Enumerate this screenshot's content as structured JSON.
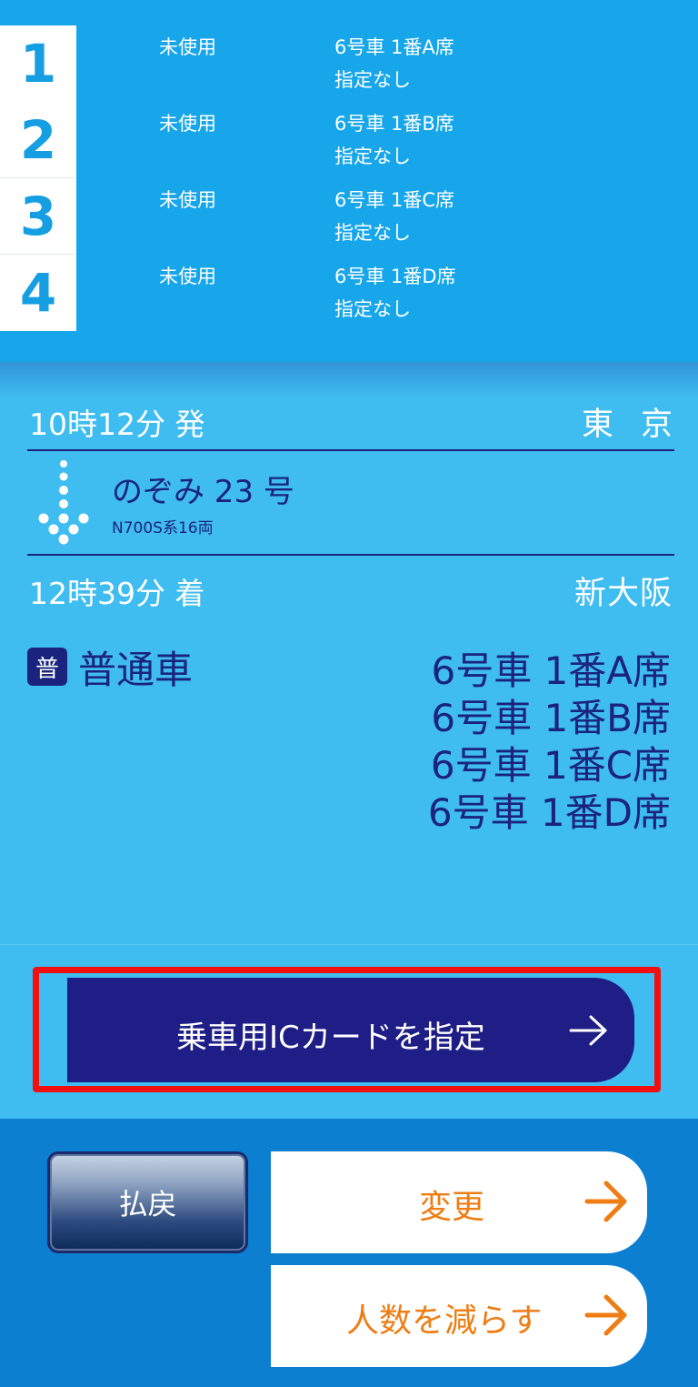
{
  "passengers": [
    {
      "number": "1",
      "status": "未使用",
      "seat": "6号車 1番A席",
      "preference": "指定なし"
    },
    {
      "number": "2",
      "status": "未使用",
      "seat": "6号車 1番B席",
      "preference": "指定なし"
    },
    {
      "number": "3",
      "status": "未使用",
      "seat": "6号車 1番C席",
      "preference": "指定なし"
    },
    {
      "number": "4",
      "status": "未使用",
      "seat": "6号車 1番D席",
      "preference": "指定なし"
    }
  ],
  "journey": {
    "departure_time": "10時12分 発",
    "departure_station": "東京",
    "train_name": "のぞみ 23 号",
    "train_type": "N700S系16両",
    "arrival_time": "12時39分 着",
    "arrival_station": "新大阪",
    "class_badge": "普",
    "class_name": "普通車",
    "seats": [
      "6号車 1番A席",
      "6号車 1番B席",
      "6号車 1番C席",
      "6号車 1番D席"
    ]
  },
  "ic_button": {
    "label": "乗車用ICカードを指定",
    "icon": "arrow-right-icon"
  },
  "actions": {
    "refund_label": "払戻",
    "change_label": "変更",
    "reduce_label": "人数を減らす",
    "arrow_icon": "arrow-right-icon"
  },
  "colors": {
    "header_blue": "#17a6ea",
    "panel_blue": "#3fbcf0",
    "navy": "#1a237e",
    "action_blue": "#0c7fd1",
    "orange": "#ee7d14",
    "highlight_red": "#f01010"
  }
}
